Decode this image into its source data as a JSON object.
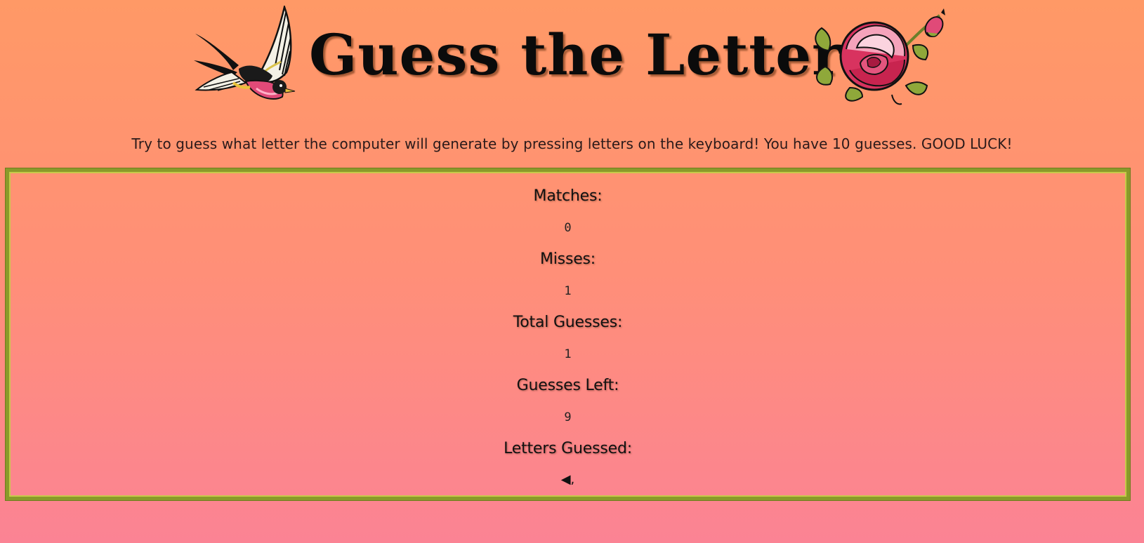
{
  "page": {
    "title": "Guess the Letter",
    "instructions": "Try to guess what letter the computer will generate by pressing letters on the keyboard! You have 10 guesses. GOOD LUCK!"
  },
  "decorations": {
    "left_image": "swallow-icon",
    "right_image": "rose-icon"
  },
  "stats": {
    "matches_label": "Matches:",
    "matches_value": "0",
    "misses_label": "Misses:",
    "misses_value": "1",
    "total_label": "Total Guesses:",
    "total_value": "1",
    "left_label": "Guesses Left:",
    "left_value": "9",
    "letters_label": "Letters Guessed:",
    "letters_value": "◀,"
  },
  "colors": {
    "background_top": "#ff9966",
    "background_bottom": "#fb8394",
    "border": "#8a9a2a"
  }
}
